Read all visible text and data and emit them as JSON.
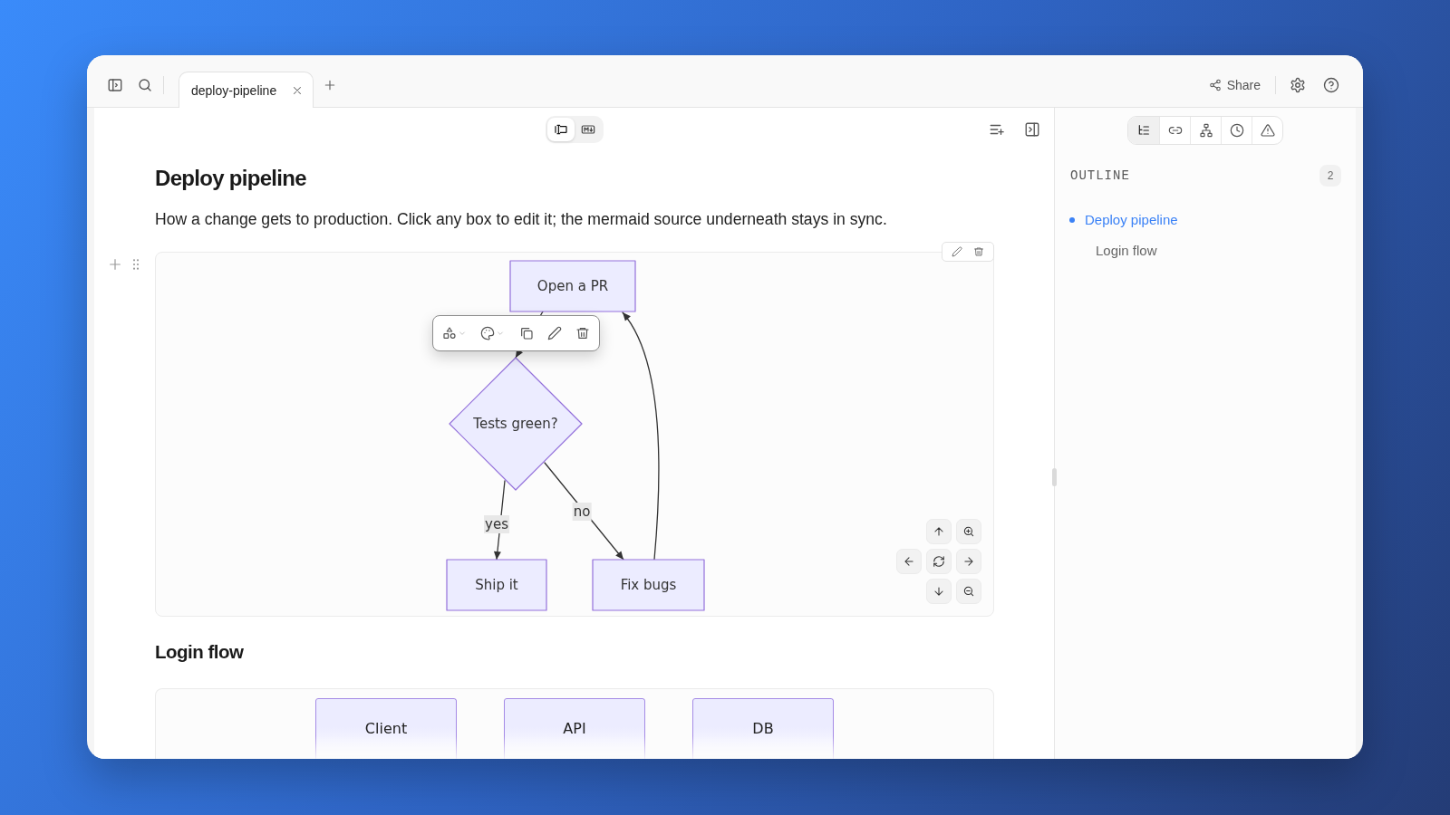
{
  "top_bar": {
    "tabs": [
      {
        "label": "deploy-pipeline",
        "selected": true
      }
    ],
    "share": "Share"
  },
  "editor": {
    "view_modes": [
      {
        "kind": "visual",
        "selected": true
      },
      {
        "kind": "markdown",
        "selected": false
      }
    ],
    "title": "Deploy pipeline",
    "description": "How a change gets to production. Click any box to edit it; the mermaid source underneath stays in sync.",
    "flowchart": {
      "nodes": [
        {
          "label": "Open a PR",
          "kind": "process"
        },
        {
          "label": "Tests green?",
          "kind": "decision"
        },
        {
          "label": "Ship it",
          "kind": "process"
        },
        {
          "label": "Fix bugs",
          "kind": "process"
        }
      ],
      "edge_labels": [
        "yes",
        "no"
      ]
    },
    "sections": [
      {
        "heading": "Login flow",
        "participants": [
          "Client",
          "API",
          "DB"
        ]
      }
    ]
  },
  "side_panel": {
    "tabs": [
      {
        "kind": "outline",
        "selected": true
      },
      {
        "kind": "links",
        "selected": false
      },
      {
        "kind": "hierarchy",
        "selected": false
      },
      {
        "kind": "history",
        "selected": false
      },
      {
        "kind": "warnings",
        "selected": false
      }
    ],
    "outline": {
      "title": "OUTLINE",
      "count": "2",
      "items": [
        {
          "label": "Deploy pipeline",
          "selected": true,
          "children": [
            {
              "label": "Login flow",
              "selected": false
            }
          ]
        }
      ]
    }
  }
}
